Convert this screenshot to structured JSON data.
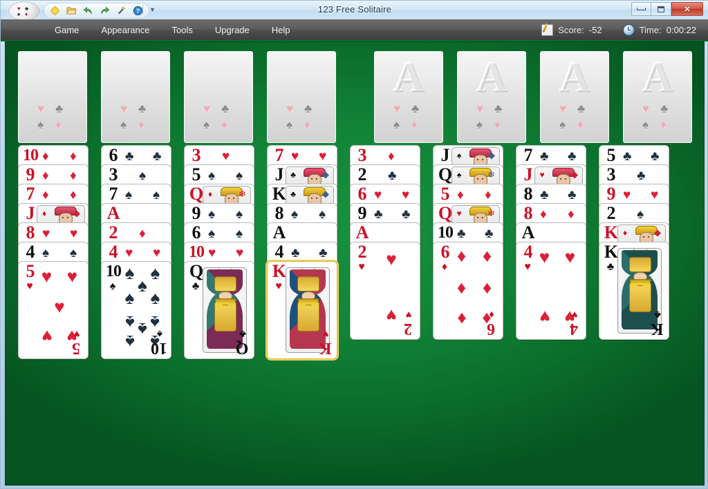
{
  "window": {
    "title": "123 Free Solitaire",
    "controls": {
      "minimize": "Minimize",
      "maximize": "Maximize",
      "close": "✕"
    }
  },
  "toolbar": {
    "orb_label": "application-menu",
    "buttons": [
      {
        "name": "new-game-icon",
        "label": "New Game"
      },
      {
        "name": "open-folder-icon",
        "label": "Open"
      },
      {
        "name": "undo-icon",
        "label": "Undo"
      },
      {
        "name": "redo-icon",
        "label": "Redo"
      },
      {
        "name": "hint-wand-icon",
        "label": "Hint"
      },
      {
        "name": "help-icon",
        "label": "Help"
      }
    ],
    "overflow_chevron": "☰"
  },
  "menubar": {
    "items": [
      "Game",
      "Appearance",
      "Tools",
      "Upgrade",
      "Help"
    ]
  },
  "status": {
    "score_label": "Score:",
    "score_value": "-52",
    "time_label": "Time:",
    "time_value": "0:00:22"
  },
  "board": {
    "felt_color": "#0f8a3a",
    "free_cells": [
      {
        "name": "free-cell-1",
        "empty": true
      },
      {
        "name": "free-cell-2",
        "empty": true
      },
      {
        "name": "free-cell-3",
        "empty": true
      },
      {
        "name": "free-cell-4",
        "empty": true
      }
    ],
    "foundations": [
      {
        "name": "foundation-1",
        "placeholder": "A",
        "empty": true
      },
      {
        "name": "foundation-2",
        "placeholder": "A",
        "empty": true
      },
      {
        "name": "foundation-3",
        "placeholder": "A",
        "empty": true
      },
      {
        "name": "foundation-4",
        "placeholder": "A",
        "empty": true
      }
    ],
    "slot_pips": [
      "♥",
      "♣",
      "♠",
      "♦"
    ],
    "suit_glyphs": {
      "hearts": "♥",
      "diamonds": "♦",
      "clubs": "♣",
      "spades": "♠"
    },
    "selected_card": "K♥",
    "columns": [
      {
        "name": "tableau-column-1",
        "cards": [
          {
            "rank": "10",
            "suit": "♦",
            "color": "red",
            "type": "number"
          },
          {
            "rank": "9",
            "suit": "♦",
            "color": "red",
            "type": "number"
          },
          {
            "rank": "7",
            "suit": "♦",
            "color": "red",
            "type": "number"
          },
          {
            "rank": "J",
            "suit": "♦",
            "color": "red",
            "type": "court"
          },
          {
            "rank": "8",
            "suit": "♥",
            "color": "red",
            "type": "number"
          },
          {
            "rank": "4",
            "suit": "♠",
            "color": "black",
            "type": "number"
          },
          {
            "rank": "5",
            "suit": "♥",
            "color": "red",
            "type": "number",
            "face": true
          }
        ]
      },
      {
        "name": "tableau-column-2",
        "cards": [
          {
            "rank": "6",
            "suit": "♣",
            "color": "black",
            "type": "number"
          },
          {
            "rank": "3",
            "suit": "♠",
            "color": "black",
            "type": "number"
          },
          {
            "rank": "7",
            "suit": "♠",
            "color": "black",
            "type": "number"
          },
          {
            "rank": "A",
            "suit": "♦",
            "color": "red",
            "type": "number"
          },
          {
            "rank": "2",
            "suit": "♦",
            "color": "red",
            "type": "number"
          },
          {
            "rank": "4",
            "suit": "♥",
            "color": "red",
            "type": "number"
          },
          {
            "rank": "10",
            "suit": "♠",
            "color": "black",
            "type": "number",
            "face": true
          }
        ]
      },
      {
        "name": "tableau-column-3",
        "cards": [
          {
            "rank": "3",
            "suit": "♥",
            "color": "red",
            "type": "number"
          },
          {
            "rank": "5",
            "suit": "♠",
            "color": "black",
            "type": "number"
          },
          {
            "rank": "Q",
            "suit": "♦",
            "color": "red",
            "type": "court"
          },
          {
            "rank": "9",
            "suit": "♠",
            "color": "black",
            "type": "number"
          },
          {
            "rank": "6",
            "suit": "♠",
            "color": "black",
            "type": "number"
          },
          {
            "rank": "10",
            "suit": "♥",
            "color": "red",
            "type": "number"
          },
          {
            "rank": "Q",
            "suit": "♣",
            "color": "black",
            "type": "court",
            "face": true
          }
        ]
      },
      {
        "name": "tableau-column-4",
        "cards": [
          {
            "rank": "7",
            "suit": "♥",
            "color": "red",
            "type": "number"
          },
          {
            "rank": "J",
            "suit": "♣",
            "color": "black",
            "type": "court"
          },
          {
            "rank": "K",
            "suit": "♣",
            "color": "black",
            "type": "court"
          },
          {
            "rank": "8",
            "suit": "♠",
            "color": "black",
            "type": "number"
          },
          {
            "rank": "A",
            "suit": "♠",
            "color": "black",
            "type": "number"
          },
          {
            "rank": "4",
            "suit": "♣",
            "color": "black",
            "type": "number"
          },
          {
            "rank": "K",
            "suit": "♥",
            "color": "red",
            "type": "court",
            "face": true,
            "selected": true
          }
        ]
      },
      {
        "name": "tableau-column-5",
        "cards": [
          {
            "rank": "3",
            "suit": "♦",
            "color": "red",
            "type": "number"
          },
          {
            "rank": "2",
            "suit": "♣",
            "color": "black",
            "type": "number"
          },
          {
            "rank": "6",
            "suit": "♥",
            "color": "red",
            "type": "number"
          },
          {
            "rank": "9",
            "suit": "♣",
            "color": "black",
            "type": "number"
          },
          {
            "rank": "A",
            "suit": "♥",
            "color": "red",
            "type": "number"
          },
          {
            "rank": "2",
            "suit": "♥",
            "color": "red",
            "type": "number",
            "face": true
          }
        ]
      },
      {
        "name": "tableau-column-6",
        "cards": [
          {
            "rank": "J",
            "suit": "♠",
            "color": "black",
            "type": "court"
          },
          {
            "rank": "Q",
            "suit": "♠",
            "color": "black",
            "type": "court"
          },
          {
            "rank": "5",
            "suit": "♦",
            "color": "red",
            "type": "number"
          },
          {
            "rank": "Q",
            "suit": "♥",
            "color": "red",
            "type": "court"
          },
          {
            "rank": "10",
            "suit": "♣",
            "color": "black",
            "type": "number"
          },
          {
            "rank": "6",
            "suit": "♦",
            "color": "red",
            "type": "number",
            "face": true
          }
        ]
      },
      {
        "name": "tableau-column-7",
        "cards": [
          {
            "rank": "7",
            "suit": "♣",
            "color": "black",
            "type": "number"
          },
          {
            "rank": "J",
            "suit": "♥",
            "color": "red",
            "type": "court"
          },
          {
            "rank": "8",
            "suit": "♣",
            "color": "black",
            "type": "number"
          },
          {
            "rank": "8",
            "suit": "♦",
            "color": "red",
            "type": "number"
          },
          {
            "rank": "A",
            "suit": "♣",
            "color": "black",
            "type": "number"
          },
          {
            "rank": "4",
            "suit": "♥",
            "color": "red",
            "type": "number",
            "face": true
          }
        ]
      },
      {
        "name": "tableau-column-8",
        "cards": [
          {
            "rank": "5",
            "suit": "♣",
            "color": "black",
            "type": "number"
          },
          {
            "rank": "3",
            "suit": "♣",
            "color": "black",
            "type": "number"
          },
          {
            "rank": "9",
            "suit": "♥",
            "color": "red",
            "type": "number"
          },
          {
            "rank": "2",
            "suit": "♠",
            "color": "black",
            "type": "number"
          },
          {
            "rank": "K",
            "suit": "♦",
            "color": "red",
            "type": "court"
          },
          {
            "rank": "K",
            "suit": "♣",
            "color": "black",
            "type": "court",
            "face": true
          }
        ]
      }
    ]
  }
}
